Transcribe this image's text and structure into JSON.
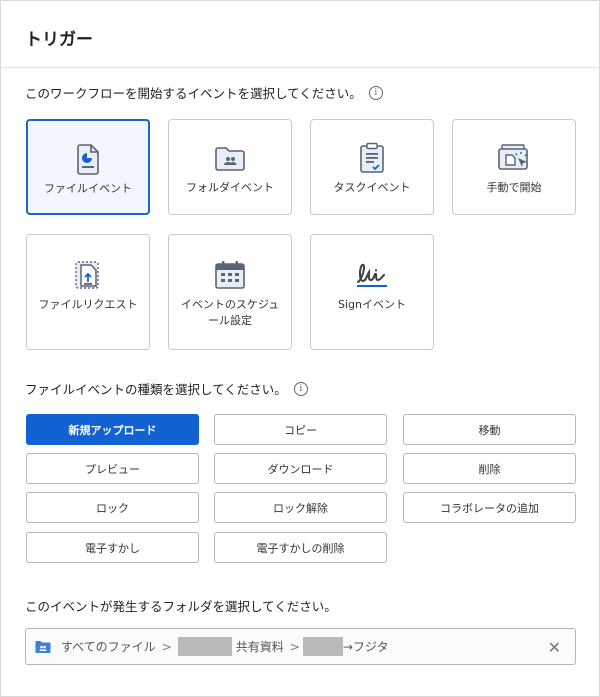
{
  "title": "トリガー",
  "event_prompt": "このワークフローを開始するイベントを選択してください。",
  "info_glyph": "i",
  "event_cards": [
    {
      "label": "ファイルイベント",
      "icon": "file-icon",
      "selected": true
    },
    {
      "label": "フォルダイベント",
      "icon": "folder-icon",
      "selected": false
    },
    {
      "label": "タスクイベント",
      "icon": "task-clipboard-icon",
      "selected": false
    },
    {
      "label": "手動で開始",
      "icon": "manual-start-icon",
      "selected": false
    },
    {
      "label": "ファイルリクエスト",
      "icon": "file-request-icon",
      "selected": false
    },
    {
      "label": "イベントのスケジュール設定",
      "icon": "calendar-icon",
      "selected": false
    },
    {
      "label": "Signイベント",
      "icon": "sign-icon",
      "selected": false
    }
  ],
  "file_event_prompt": "ファイルイベントの種類を選択してください。",
  "file_event_types": [
    {
      "label": "新規アップロード",
      "selected": true
    },
    {
      "label": "コピー",
      "selected": false
    },
    {
      "label": "移動",
      "selected": false
    },
    {
      "label": "プレビュー",
      "selected": false
    },
    {
      "label": "ダウンロード",
      "selected": false
    },
    {
      "label": "削除",
      "selected": false
    },
    {
      "label": "ロック",
      "selected": false
    },
    {
      "label": "ロック解除",
      "selected": false
    },
    {
      "label": "コラボレータの追加",
      "selected": false
    },
    {
      "label": "電子すかし",
      "selected": false
    },
    {
      "label": "電子すかしの削除",
      "selected": false
    }
  ],
  "folder_prompt": "このイベントが発生するフォルダを選択してください。",
  "folder_path": {
    "root": "すべてのファイル",
    "separator": ">",
    "shared": "共有資料",
    "last": "→フジタ",
    "clear": "✕"
  },
  "colors": {
    "accent": "#1262d3",
    "selected_card_border": "#1a66c9",
    "selected_card_bg": "#f3f7fd",
    "icon": "#5a6472"
  }
}
